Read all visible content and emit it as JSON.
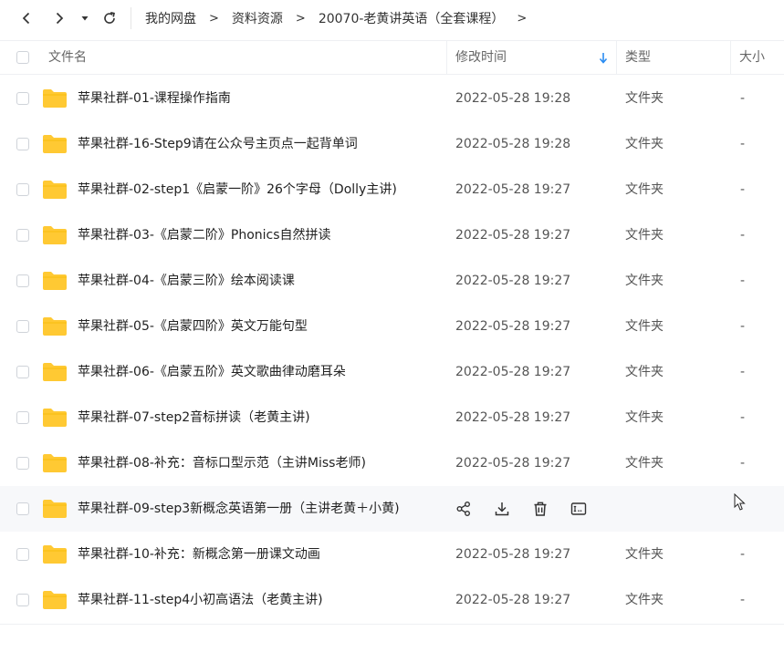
{
  "breadcrumb": {
    "items": [
      "我的网盘",
      "资料资源",
      "20070-老黄讲英语（全套课程）"
    ],
    "separator": ">"
  },
  "header": {
    "name": "文件名",
    "modified": "修改时间",
    "type": "类型",
    "size": "大小"
  },
  "files": [
    {
      "name": "苹果社群-01-课程操作指南",
      "date": "2022-05-28 19:28",
      "type": "文件夹",
      "size": "-"
    },
    {
      "name": "苹果社群-16-Step9请在公众号主页点一起背单词",
      "date": "2022-05-28 19:28",
      "type": "文件夹",
      "size": "-"
    },
    {
      "name": "苹果社群-02-step1《启蒙一阶》26个字母（Dolly主讲)",
      "date": "2022-05-28 19:27",
      "type": "文件夹",
      "size": "-"
    },
    {
      "name": "苹果社群-03-《启蒙二阶》Phonics自然拼读",
      "date": "2022-05-28 19:27",
      "type": "文件夹",
      "size": "-"
    },
    {
      "name": "苹果社群-04-《启蒙三阶》绘本阅读课",
      "date": "2022-05-28 19:27",
      "type": "文件夹",
      "size": "-"
    },
    {
      "name": "苹果社群-05-《启蒙四阶》英文万能句型",
      "date": "2022-05-28 19:27",
      "type": "文件夹",
      "size": "-"
    },
    {
      "name": "苹果社群-06-《启蒙五阶》英文歌曲律动磨耳朵",
      "date": "2022-05-28 19:27",
      "type": "文件夹",
      "size": "-"
    },
    {
      "name": "苹果社群-07-step2音标拼读（老黄主讲)",
      "date": "2022-05-28 19:27",
      "type": "文件夹",
      "size": "-"
    },
    {
      "name": "苹果社群-08-补充：音标口型示范（主讲Miss老师)",
      "date": "2022-05-28 19:27",
      "type": "文件夹",
      "size": "-"
    },
    {
      "name": "苹果社群-09-step3新概念英语第一册（主讲老黄＋小黄)",
      "date": "",
      "type": "",
      "size": ""
    },
    {
      "name": "苹果社群-10-补充：新概念第一册课文动画",
      "date": "2022-05-28 19:27",
      "type": "文件夹",
      "size": "-"
    },
    {
      "name": "苹果社群-11-step4小初高语法（老黄主讲)",
      "date": "2022-05-28 19:27",
      "type": "文件夹",
      "size": "-"
    }
  ],
  "colors": {
    "folder": "#ffc933",
    "sort_arrow": "#2a8cf2",
    "hover_row": "#f7f8fa"
  },
  "icons": {
    "row_actions": [
      "share-icon",
      "download-icon",
      "delete-icon",
      "rename-icon"
    ]
  }
}
